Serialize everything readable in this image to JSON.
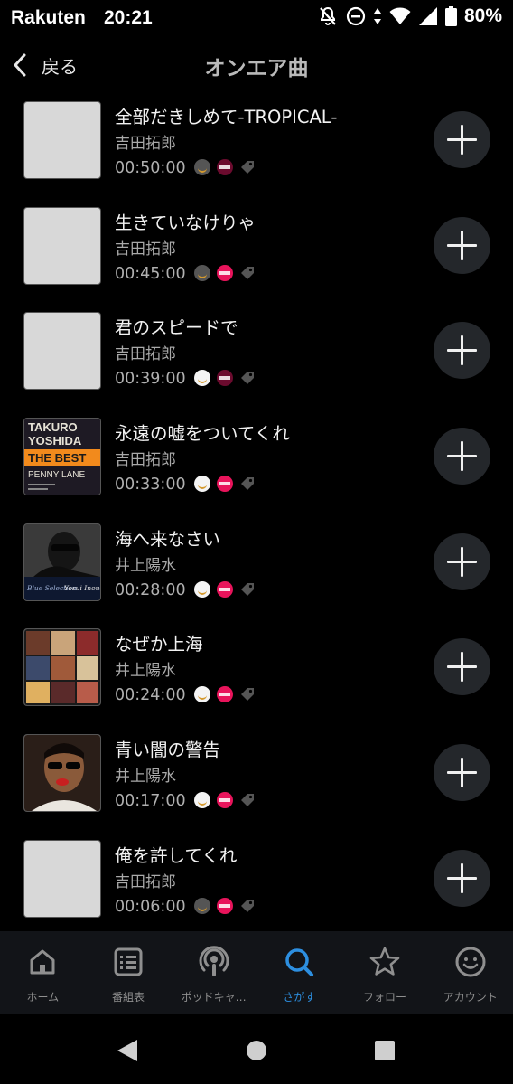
{
  "status_bar": {
    "carrier": "Rakuten",
    "time": "20:21",
    "battery": "80%"
  },
  "header": {
    "back_label": "戻る",
    "title": "オンエア曲"
  },
  "tracks": [
    {
      "title": "全部だきしめて-TROPICAL-",
      "artist": "吉田拓郎",
      "time": "00:50:00",
      "amazon": false,
      "rakuten": false
    },
    {
      "title": "生きていなけりゃ",
      "artist": "吉田拓郎",
      "time": "00:45:00",
      "amazon": false,
      "rakuten": true
    },
    {
      "title": "君のスピードで",
      "artist": "吉田拓郎",
      "time": "00:39:00",
      "amazon": true,
      "rakuten": false
    },
    {
      "title": "永遠の嘘をついてくれ",
      "artist": "吉田拓郎",
      "time": "00:33:00",
      "amazon": true,
      "rakuten": true
    },
    {
      "title": "海へ来なさい",
      "artist": "井上陽水",
      "time": "00:28:00",
      "amazon": true,
      "rakuten": true
    },
    {
      "title": "なぜか上海",
      "artist": "井上陽水",
      "time": "00:24:00",
      "amazon": true,
      "rakuten": true
    },
    {
      "title": "青い闇の警告",
      "artist": "井上陽水",
      "time": "00:17:00",
      "amazon": true,
      "rakuten": true
    },
    {
      "title": "俺を許してくれ",
      "artist": "吉田拓郎",
      "time": "00:06:00",
      "amazon": false,
      "rakuten": true
    }
  ],
  "album_art": {
    "takuro_best": {
      "line1": "TAKURO",
      "line2": "YOSHIDA",
      "line3": "THE BEST",
      "line4": "PENNY LANE"
    },
    "blue_selection": {
      "left": "Blue Selection",
      "right": "Yosui Inoue"
    }
  },
  "bottom_nav": [
    {
      "label": "ホーム",
      "icon": "home-icon",
      "active": false
    },
    {
      "label": "番組表",
      "icon": "program-list-icon",
      "active": false
    },
    {
      "label": "ポッドキャ…",
      "icon": "podcast-icon",
      "active": false
    },
    {
      "label": "さがす",
      "icon": "search-icon",
      "active": true
    },
    {
      "label": "フォロー",
      "icon": "star-icon",
      "active": false
    },
    {
      "label": "アカウント",
      "icon": "account-icon",
      "active": false
    }
  ],
  "colors": {
    "accent": "#2d8fe0",
    "background": "#000000",
    "rakuten_red": "#e8145b",
    "add_button": "#24272b"
  }
}
